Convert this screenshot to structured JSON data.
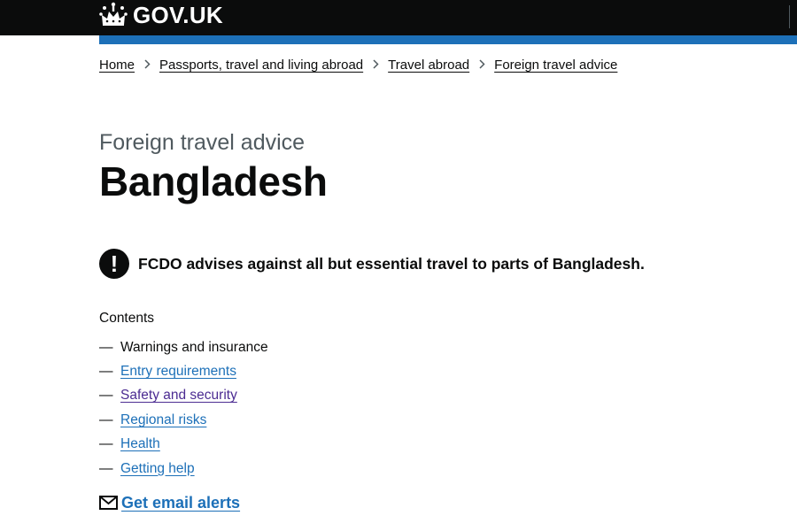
{
  "header": {
    "logo_text": "GOV.UK"
  },
  "breadcrumbs": [
    {
      "label": "Home"
    },
    {
      "label": "Passports, travel and living abroad"
    },
    {
      "label": "Travel abroad"
    },
    {
      "label": "Foreign travel advice"
    }
  ],
  "page": {
    "caption": "Foreign travel advice",
    "title": "Bangladesh"
  },
  "warning": {
    "icon": "!",
    "text": "FCDO advises against all but essential travel to parts of Bangladesh."
  },
  "contents": {
    "heading": "Contents",
    "dash": "—",
    "items": [
      {
        "label": "Warnings and insurance",
        "state": "current"
      },
      {
        "label": "Entry requirements",
        "state": "link"
      },
      {
        "label": "Safety and security",
        "state": "visited"
      },
      {
        "label": "Regional risks",
        "state": "link"
      },
      {
        "label": "Health",
        "state": "link"
      },
      {
        "label": "Getting help",
        "state": "link"
      }
    ]
  },
  "email_alerts": {
    "label": "Get email alerts",
    "icon": "envelope-icon"
  },
  "colors": {
    "header_bg": "#0b0c0c",
    "blue_bar": "#1d70b8",
    "link": "#1d70b8",
    "visited_link": "#4c2c92",
    "text": "#0b0c0c",
    "secondary_text": "#505a5f"
  }
}
